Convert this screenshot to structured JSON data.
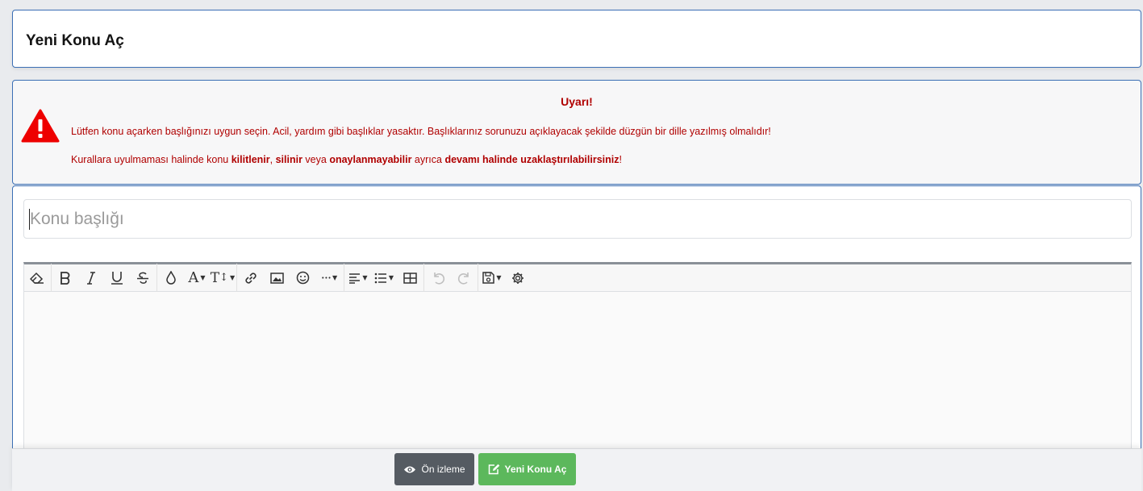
{
  "page": {
    "title": "Yeni Konu Aç"
  },
  "warning": {
    "title": "Uyarı!",
    "line1": "Lütfen konu açarken başlığınızı uygun seçin. Acil, yardım gibi başlıklar yasaktır. Başlıklarınız sorunuzu açıklayacak şekilde düzgün bir dille yazılmış olmalıdır!",
    "line2_parts": {
      "p1": "Kurallara uyulmaması halinde konu ",
      "b1": "kilitlenir",
      "p2": ", ",
      "b2": "silinir",
      "p3": " veya ",
      "b3": "onaylanmayabilir",
      "p4": " ayrıca ",
      "b4": "devamı halinde uzaklaştırılabilirsiniz",
      "p5": "!"
    },
    "color": "#b00000"
  },
  "editor": {
    "title_placeholder": "Konu başlığı",
    "title_value": "",
    "toolbar_icons": [
      "eraser-icon",
      "bold-icon",
      "italic-icon",
      "underline-icon",
      "strikethrough-icon",
      "text-color-icon",
      "font-family-icon",
      "font-size-icon",
      "link-icon",
      "image-icon",
      "smiley-icon",
      "more-icon",
      "align-icon",
      "list-icon",
      "table-icon",
      "undo-icon",
      "redo-icon",
      "drafts-icon",
      "settings-icon"
    ]
  },
  "footer": {
    "preview_label": "Ön izleme",
    "submit_label": "Yeni Konu Aç",
    "submit_color": "#5cb85c",
    "preview_color": "#555b62"
  },
  "colors": {
    "accent_border": "#3b6fb5",
    "background": "#e9ebee"
  }
}
